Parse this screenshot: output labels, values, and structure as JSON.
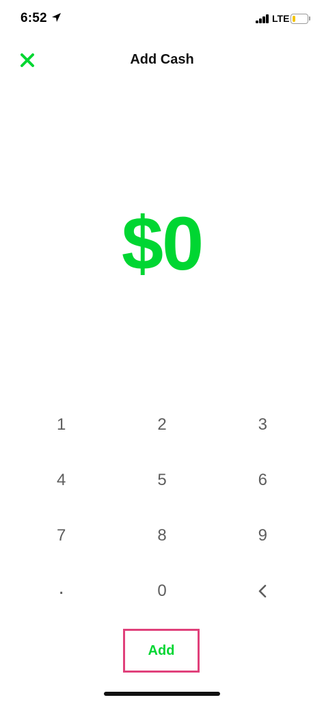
{
  "status_bar": {
    "time": "6:52",
    "network": "LTE",
    "location_icon": "location-arrow-icon",
    "signal_icon": "cellular-signal-icon",
    "battery_icon": "battery-icon",
    "battery_level": 0.2,
    "battery_color": "#f5c400"
  },
  "header": {
    "title": "Add Cash",
    "close_icon": "close-icon"
  },
  "amount": {
    "display": "$0"
  },
  "keypad": {
    "keys": [
      "1",
      "2",
      "3",
      "4",
      "5",
      "6",
      "7",
      "8",
      "9",
      ".",
      "0"
    ],
    "backspace_icon": "backspace-chevron-icon"
  },
  "actions": {
    "add_label": "Add"
  },
  "colors": {
    "accent": "#00d632",
    "highlight_border": "#e0417b",
    "key_text": "#5e5e5e"
  }
}
